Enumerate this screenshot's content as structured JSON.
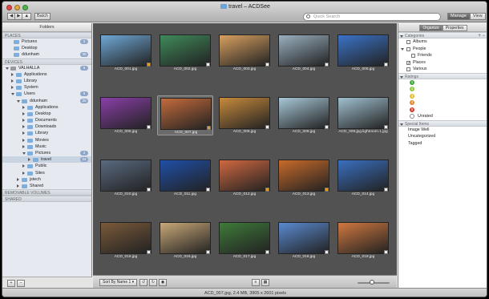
{
  "window": {
    "title": "travel – ACDSee"
  },
  "toolbar": {
    "back": "◀",
    "forward": "▶",
    "up": "▲",
    "batch": "Batch",
    "search_placeholder": "Quick Search",
    "manage": "Manage",
    "view": "View"
  },
  "sidebar": {
    "title": "Folders",
    "places_header": "PLACES",
    "places": [
      {
        "label": "Pictures",
        "count": "2"
      },
      {
        "label": "Desktop",
        "count": ""
      },
      {
        "label": "ddunham",
        "count": "30"
      }
    ],
    "devices_header": "DEVICES",
    "devices": [
      {
        "label": "VALHALLA",
        "count": "5",
        "indent": 0
      },
      {
        "label": "Applications",
        "count": "",
        "indent": 1
      },
      {
        "label": "Library",
        "count": "",
        "indent": 1
      },
      {
        "label": "System",
        "count": "",
        "indent": 1
      },
      {
        "label": "Users",
        "count": "5",
        "indent": 1
      },
      {
        "label": "ddunham",
        "count": "30",
        "indent": 2
      },
      {
        "label": "Applications",
        "count": "",
        "indent": 3
      },
      {
        "label": "Desktop",
        "count": "",
        "indent": 3
      },
      {
        "label": "Documents",
        "count": "",
        "indent": 3
      },
      {
        "label": "Downloads",
        "count": "",
        "indent": 3
      },
      {
        "label": "Library",
        "count": "",
        "indent": 3
      },
      {
        "label": "Movies",
        "count": "",
        "indent": 3
      },
      {
        "label": "Music",
        "count": "",
        "indent": 3
      },
      {
        "label": "Pictures",
        "count": "2",
        "indent": 3
      },
      {
        "label": "travel",
        "count": "24",
        "indent": 4
      },
      {
        "label": "Public",
        "count": "",
        "indent": 3
      },
      {
        "label": "Sites",
        "count": "",
        "indent": 3
      },
      {
        "label": "jstech",
        "count": "",
        "indent": 2
      },
      {
        "label": "Shared",
        "count": "",
        "indent": 2
      }
    ],
    "removable_header": "REMOVABLE VOLUMES",
    "shared_header": "SHARED",
    "add": "+",
    "remove": "−"
  },
  "thumbnails": [
    {
      "name": "ACD_001.jpg",
      "color": "#6fa8d6",
      "checked": true
    },
    {
      "name": "ACD_002.jpg",
      "color": "#3f8a5a",
      "checked": false
    },
    {
      "name": "ACD_003.jpg",
      "color": "#d8a060",
      "checked": false
    },
    {
      "name": "ACD_004.jpg",
      "color": "#9ab0c0",
      "checked": false
    },
    {
      "name": "ACD_005.jpg",
      "color": "#3b73c8",
      "checked": false
    },
    {
      "name": "ACD_006.jpg",
      "color": "#8a3fa8",
      "checked": false
    },
    {
      "name": "ACD_007.jpg",
      "color": "#c46b3c",
      "checked": true
    },
    {
      "name": "ACD_008.jpg",
      "color": "#c88a3c",
      "checked": false
    },
    {
      "name": "ACD_009.jpg",
      "color": "#a8c8d8",
      "checked": false
    },
    {
      "name": "ACD_009.jpg.lightroom.1.jpg",
      "color": "#a0c0d0",
      "checked": false
    },
    {
      "name": "ACD_010.jpg",
      "color": "#5a6a80",
      "checked": false
    },
    {
      "name": "ACD_011.jpg",
      "color": "#1f4fa8",
      "checked": false
    },
    {
      "name": "ACD_012.jpg",
      "color": "#d06840",
      "checked": true
    },
    {
      "name": "ACD_013.jpg",
      "color": "#c86a2a",
      "checked": true
    },
    {
      "name": "ACD_014.jpg",
      "color": "#3a6fc0",
      "checked": false
    },
    {
      "name": "ACD_015.jpg",
      "color": "#7a5a3a",
      "checked": false
    },
    {
      "name": "ACD_016.jpg",
      "color": "#c8a878",
      "checked": false
    },
    {
      "name": "ACD_017.jpg",
      "color": "#3f7a3a",
      "checked": false
    },
    {
      "name": "ACD_018.jpg",
      "color": "#5a8ad0",
      "checked": false
    },
    {
      "name": "ACD_019.jpg",
      "color": "#d07840",
      "checked": false
    }
  ],
  "bottombar": {
    "sort": "Sort By Name 1 ▾",
    "zoom_level": 0.45
  },
  "rpanel": {
    "tabs": [
      "Organize",
      "Properties"
    ],
    "categories_header": "Categories",
    "categories": [
      {
        "label": "Albums",
        "checked": false,
        "indent": 1
      },
      {
        "label": "People",
        "checked": false,
        "indent": 1
      },
      {
        "label": "Friends",
        "checked": false,
        "indent": 2
      },
      {
        "label": "Places",
        "checked": true,
        "indent": 1
      },
      {
        "label": "Various",
        "checked": false,
        "indent": 1
      }
    ],
    "ratings_header": "Ratings",
    "ratings": [
      {
        "label": "1",
        "color": "#3aa83a"
      },
      {
        "label": "2",
        "color": "#8fc83a"
      },
      {
        "label": "3",
        "color": "#e8c02a"
      },
      {
        "label": "4",
        "color": "#e8862a"
      },
      {
        "label": "5",
        "color": "#d83a2a"
      }
    ],
    "unrated": "Unrated",
    "special_header": "Special Items",
    "special": [
      "Image Well",
      "Uncategorized",
      "Tagged"
    ]
  },
  "status": "ACD_007.jpg, 2.4 MB, 3905 x 2601 pixels"
}
